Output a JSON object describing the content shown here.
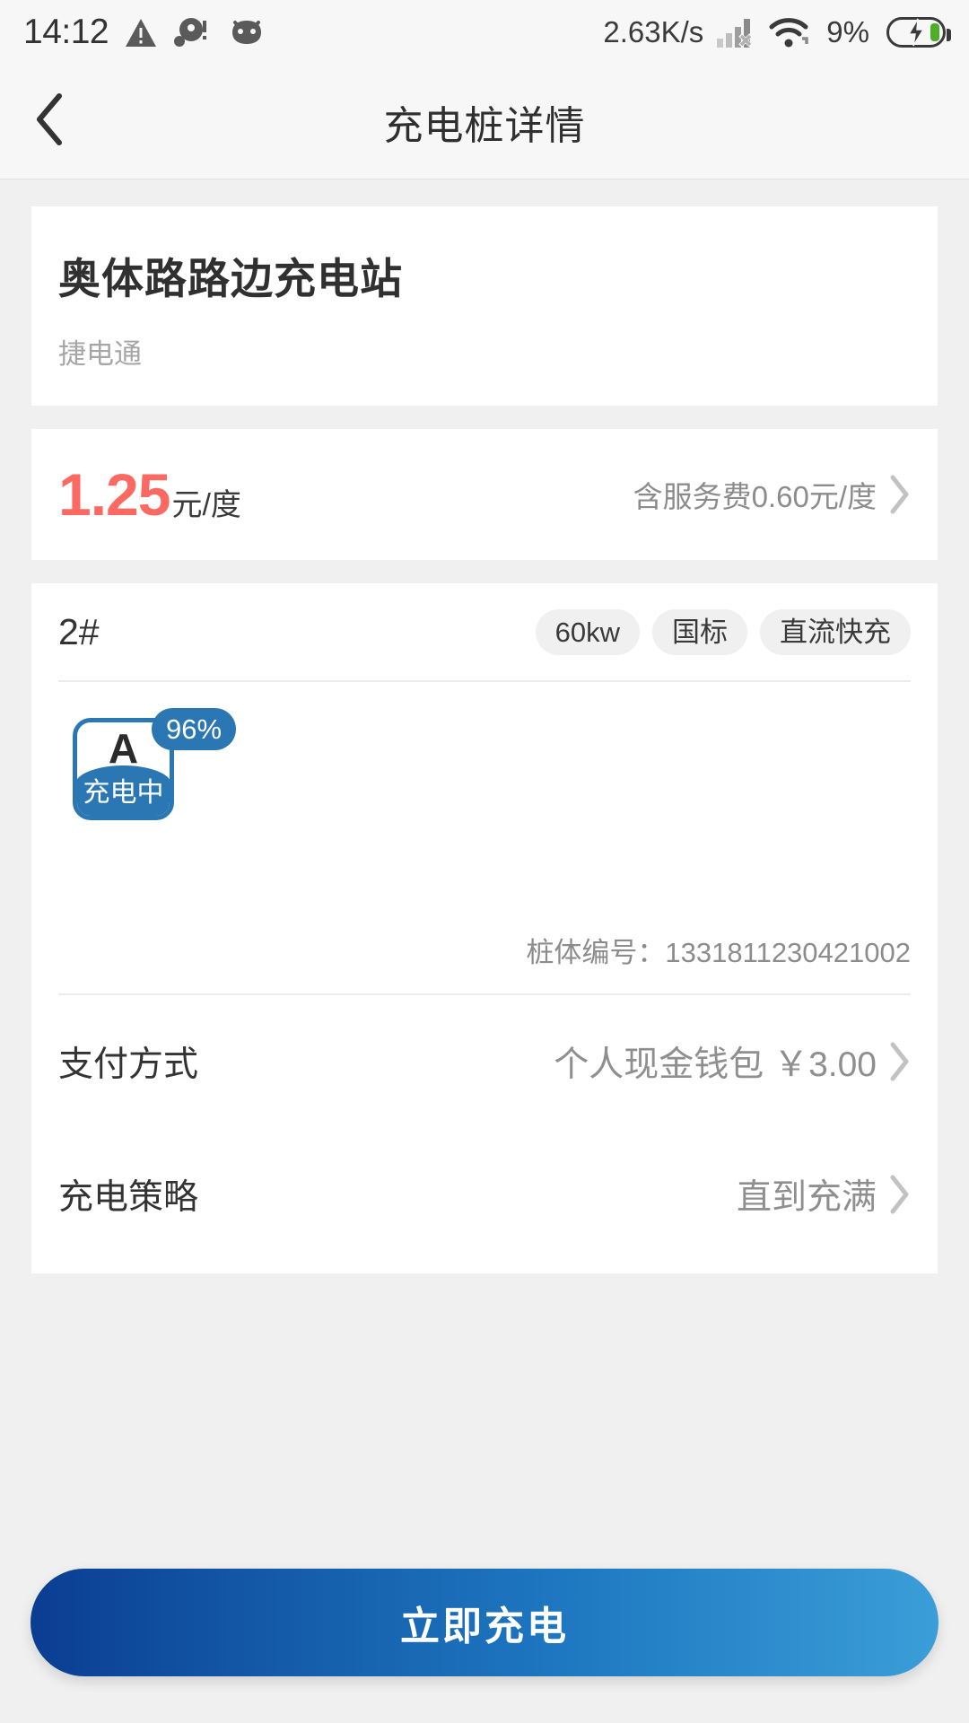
{
  "status_bar": {
    "time": "14:12",
    "network_speed": "2.63K/s",
    "battery_percent": "9%",
    "icons": [
      "warning-triangle-icon",
      "alert-dot-icon",
      "android-bug-icon",
      "signal-bars-icon",
      "wifi-icon",
      "battery-charging-icon"
    ]
  },
  "header": {
    "title": "充电桩详情",
    "back_icon": "chevron-left-icon"
  },
  "station": {
    "name": "奥体路路边充电站",
    "operator": "捷电通"
  },
  "price": {
    "amount": "1.25",
    "unit": "元/度",
    "service_fee": "含服务费0.60元/度",
    "chevron": "chevron-right-icon"
  },
  "pile": {
    "number": "2#",
    "tags": [
      "60kw",
      "国标",
      "直流快充"
    ],
    "connector": {
      "label": "A",
      "status": "充电中",
      "battery_badge": "96%"
    },
    "code_label": "桩体编号：",
    "code_value": "1331811230421002",
    "code_full": "桩体编号：1331811230421002"
  },
  "rows": [
    {
      "label": "支付方式",
      "value": "个人现金钱包  ￥3.00"
    },
    {
      "label": "充电策略",
      "value": "直到充满"
    }
  ],
  "cta": {
    "label": "立即充电"
  },
  "colors": {
    "price_red": "#fb6a62",
    "brand_blue": "#2a77b4",
    "cta_gradient_start": "#0b3d92",
    "cta_gradient_end": "#3a9ed8",
    "page_bg": "#f0f0f0",
    "battery_green": "#4caf27"
  }
}
